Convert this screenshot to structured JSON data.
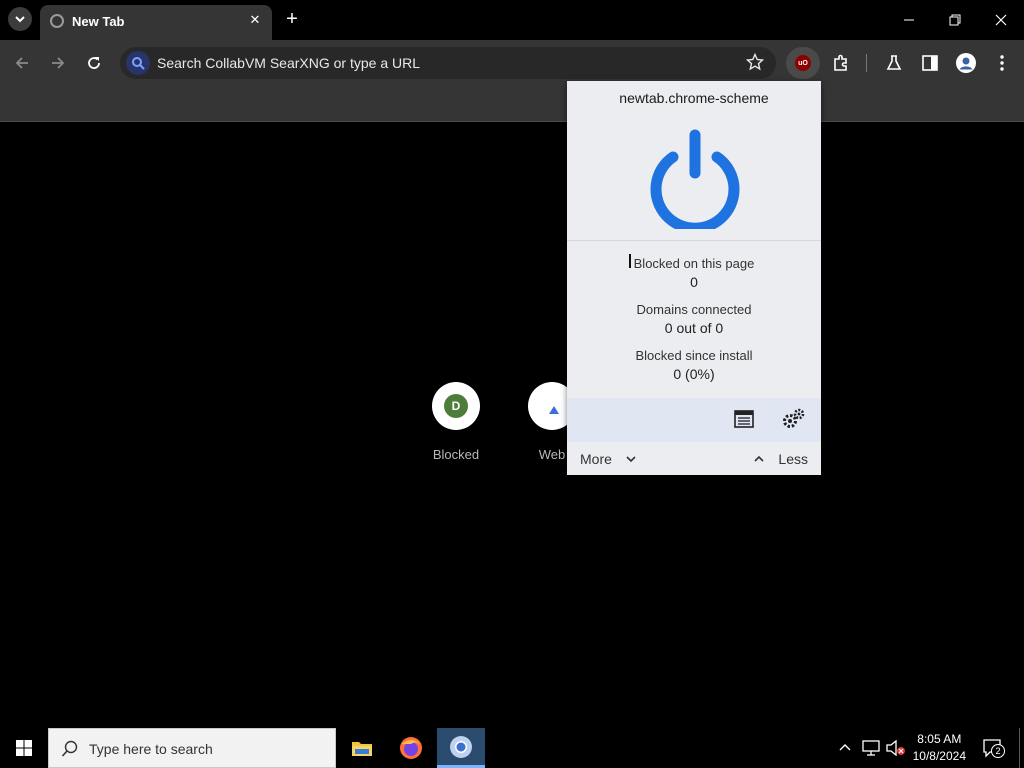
{
  "browser": {
    "tab": {
      "title": "New Tab"
    },
    "omnibox": {
      "placeholder": "Search CollabVM SearXNG or type a URL"
    },
    "extension_badge": "uO"
  },
  "shortcuts": [
    {
      "initial": "D",
      "label": "Blocked"
    },
    {
      "initial": "",
      "label": "Web"
    }
  ],
  "popup": {
    "hostname": "newtab.chrome-scheme",
    "stats": [
      {
        "label": "Blocked on this page",
        "value": "0"
      },
      {
        "label": "Domains connected",
        "value": "0 out of 0"
      },
      {
        "label": "Blocked since install",
        "value": "0 (0%)"
      }
    ],
    "more_label": "More",
    "less_label": "Less",
    "icons": {
      "power": "power-icon",
      "logger": "logger-icon",
      "settings": "settings-icon"
    },
    "accent": "#1e73e0"
  },
  "taskbar": {
    "search_placeholder": "Type here to search",
    "time": "8:05 AM",
    "date": "10/8/2024",
    "notification_count": "2"
  }
}
